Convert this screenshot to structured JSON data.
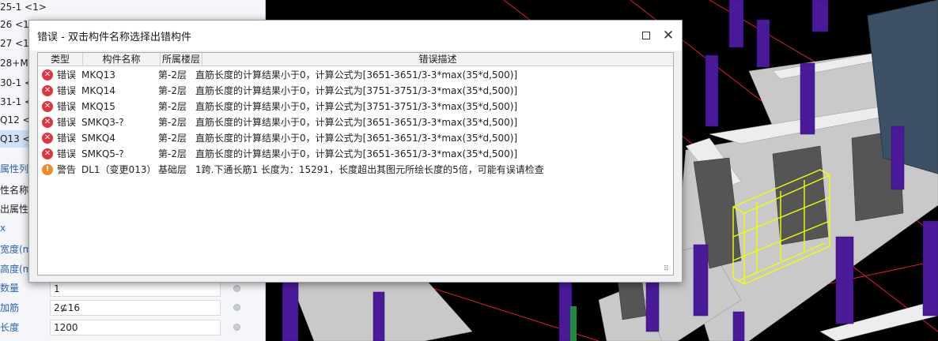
{
  "left_panel": {
    "list_items": [
      {
        "label": "25-1 <1>",
        "selected": false
      },
      {
        "label": "26 <1",
        "selected": false
      },
      {
        "label": "27 <1",
        "selected": false
      },
      {
        "label": "28+M",
        "selected": false
      },
      {
        "label": "30-1 <",
        "selected": false
      },
      {
        "label": "31-1 <",
        "selected": false
      },
      {
        "label": "Q12 <",
        "selected": false
      },
      {
        "label": "Q13 <",
        "selected": true
      }
    ],
    "section_header": "属性列表",
    "prop_name_header": "性名称",
    "props": [
      {
        "label": "出属性",
        "color": "black"
      },
      {
        "label": "x",
        "color": "blue"
      },
      {
        "label": "宽度(m",
        "color": "blue"
      },
      {
        "label": "高度(m",
        "color": "blue"
      },
      {
        "label": "数量",
        "value": "1",
        "color": "blue"
      },
      {
        "label": "加筋",
        "value": "2⊈16",
        "color": "blue"
      },
      {
        "label": "长度",
        "value": "1200",
        "color": "blue"
      }
    ]
  },
  "dialog": {
    "title": "错误 - 双击构件名称选择出错构件",
    "maximize_icon": "maximize-icon",
    "close_icon": "close-icon",
    "close_glyph": "✕",
    "columns": [
      "类型",
      "构件名称",
      "所属楼层",
      "错误描述"
    ],
    "rows": [
      {
        "icon": "error-icon",
        "type": "错误",
        "name": "MKQ13",
        "floor": "第-2层",
        "desc": "直筋长度的计算结果小于0，计算公式为[3651-3651/3-3*max(35*d,500)]"
      },
      {
        "icon": "error-icon",
        "type": "错误",
        "name": "MKQ14",
        "floor": "第-2层",
        "desc": "直筋长度的计算结果小于0，计算公式为[3751-3751/3-3*max(35*d,500)]"
      },
      {
        "icon": "error-icon",
        "type": "错误",
        "name": "MKQ15",
        "floor": "第-2层",
        "desc": "直筋长度的计算结果小于0，计算公式为[3751-3751/3-3*max(35*d,500)]"
      },
      {
        "icon": "error-icon",
        "type": "错误",
        "name": "SMKQ3-?",
        "floor": "第-2层",
        "desc": "直筋长度的计算结果小于0，计算公式为[3651-3651/3-3*max(35*d,500)]"
      },
      {
        "icon": "error-icon",
        "type": "错误",
        "name": "SMKQ4",
        "floor": "第-2层",
        "desc": "直筋长度的计算结果小于0，计算公式为[3651-3651/3-3*max(35*d,500)]"
      },
      {
        "icon": "error-icon",
        "type": "错误",
        "name": "SMKQ5-?",
        "floor": "第-2层",
        "desc": "直筋长度的计算结果小于0，计算公式为[3651-3651/3-3*max(35*d,500)]"
      },
      {
        "icon": "warning-icon",
        "type": "警告",
        "name": "DL1（变更013）",
        "floor": "基础层",
        "desc": "1跨.下通长筋1 长度为：15291，长度超出其图元所绘长度的5倍，可能有误请检查"
      }
    ]
  },
  "colors": {
    "error": "#e0353f",
    "warning": "#f08a24",
    "selected_row": "#cfe3f7",
    "viewport_bg": "#000000",
    "wall_purple": "#4a1a9a",
    "wall_gray": "#c8c8c8",
    "highlight_yellow": "#f2ff00",
    "grid_red": "#e0202a"
  }
}
